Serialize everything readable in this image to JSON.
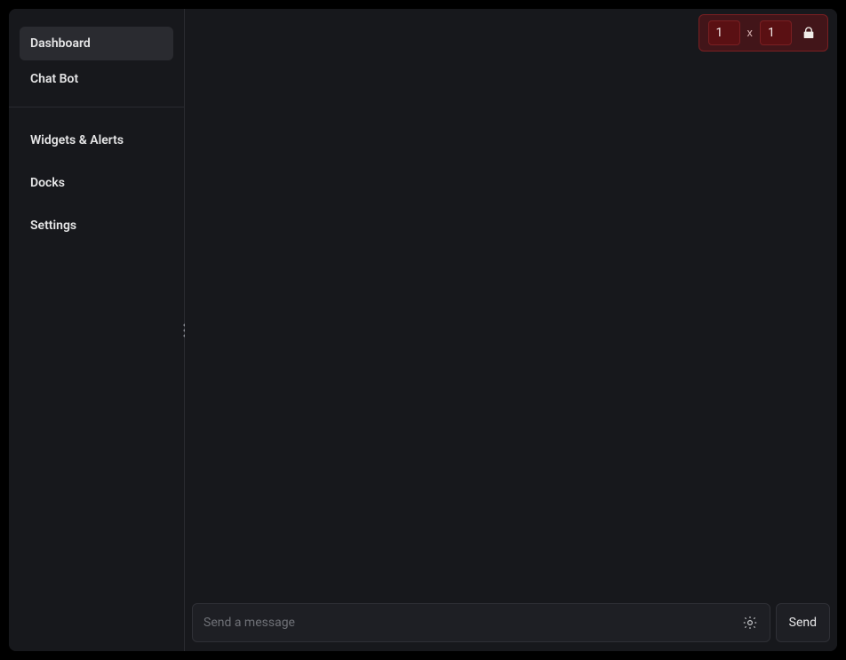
{
  "sidebar": {
    "primary": [
      {
        "label": "Dashboard",
        "active": true
      },
      {
        "label": "Chat Bot",
        "active": false
      }
    ],
    "secondary": [
      {
        "label": "Widgets & Alerts"
      },
      {
        "label": "Docks"
      },
      {
        "label": "Settings"
      }
    ]
  },
  "grid": {
    "cols": "1",
    "separator": "x",
    "rows": "1"
  },
  "composer": {
    "placeholder": "Send a message",
    "send_label": "Send"
  }
}
